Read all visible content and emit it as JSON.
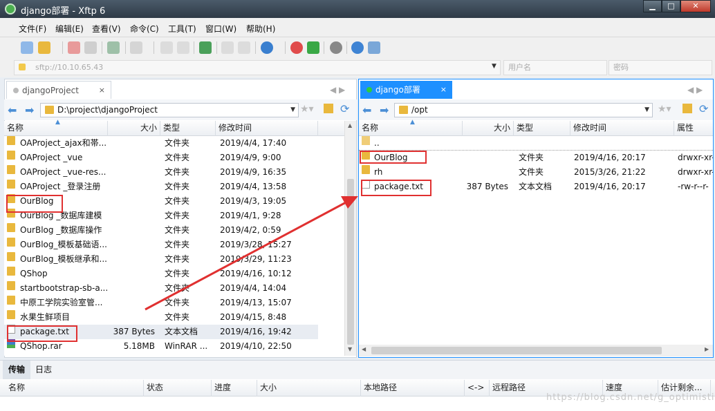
{
  "window": {
    "title": "django部署   - Xftp 6"
  },
  "menu": [
    "文件(F)",
    "编辑(E)",
    "查看(V)",
    "命令(C)",
    "工具(T)",
    "窗口(W)",
    "帮助(H)"
  ],
  "address": {
    "host": "sftp://10.10.65.43",
    "username_placeholder": "用户名",
    "password_placeholder": "密码"
  },
  "left": {
    "tab": "djangoProject",
    "tab_close": "×",
    "path": "D:\\project\\djangoProject",
    "columns": [
      "名称",
      "大小",
      "类型",
      "修改时间"
    ],
    "files": [
      {
        "name": "OAProject_ajax和帯...",
        "size": "",
        "type": "文件夹",
        "mtime": "2019/4/4, 17:40",
        "icon": "folder"
      },
      {
        "name": "OAProject _vue",
        "size": "",
        "type": "文件夹",
        "mtime": "2019/4/9, 9:00",
        "icon": "folder"
      },
      {
        "name": "OAProject _vue-res...",
        "size": "",
        "type": "文件夹",
        "mtime": "2019/4/9, 16:35",
        "icon": "folder"
      },
      {
        "name": "OAProject _登录注册",
        "size": "",
        "type": "文件夹",
        "mtime": "2019/4/4, 13:58",
        "icon": "folder"
      },
      {
        "name": "OurBlog",
        "size": "",
        "type": "文件夹",
        "mtime": "2019/4/3, 19:05",
        "icon": "folder"
      },
      {
        "name": "OurBlog _数据库建模",
        "size": "",
        "type": "文件夹",
        "mtime": "2019/4/1, 9:28",
        "icon": "folder"
      },
      {
        "name": "OurBlog _数据库操作",
        "size": "",
        "type": "文件夹",
        "mtime": "2019/4/2, 0:59",
        "icon": "folder"
      },
      {
        "name": "OurBlog_模板基础语...",
        "size": "",
        "type": "文件夹",
        "mtime": "2019/3/28, 15:27",
        "icon": "folder"
      },
      {
        "name": "OurBlog_模板继承和...",
        "size": "",
        "type": "文件夹",
        "mtime": "2019/3/29, 11:23",
        "icon": "folder"
      },
      {
        "name": "QShop",
        "size": "",
        "type": "文件夹",
        "mtime": "2019/4/16, 10:12",
        "icon": "folder"
      },
      {
        "name": "startbootstrap-sb-a...",
        "size": "",
        "type": "文件夹",
        "mtime": "2019/4/4, 14:04",
        "icon": "folder"
      },
      {
        "name": "中原工学院实验室管...",
        "size": "",
        "type": "文件夹",
        "mtime": "2019/4/13, 15:07",
        "icon": "folder"
      },
      {
        "name": "水果生鲜项目",
        "size": "",
        "type": "文件夹",
        "mtime": "2019/4/15, 8:48",
        "icon": "folder"
      },
      {
        "name": "package.txt",
        "size": "387 Bytes",
        "type": "文本文档",
        "mtime": "2019/4/16, 19:42",
        "icon": "file"
      },
      {
        "name": "QShop.rar",
        "size": "5.18MB",
        "type": "WinRAR ...",
        "mtime": "2019/4/10, 22:50",
        "icon": "rar"
      }
    ]
  },
  "right": {
    "tab": "django部署",
    "tab_close": "×",
    "path": "/opt",
    "columns": [
      "名称",
      "大小",
      "类型",
      "修改时间",
      "属性"
    ],
    "files": [
      {
        "name": "..",
        "size": "",
        "type": "",
        "mtime": "",
        "attr": "",
        "icon": "up"
      },
      {
        "name": "OurBlog",
        "size": "",
        "type": "文件夹",
        "mtime": "2019/4/16, 20:17",
        "attr": "drwxr-xr-",
        "icon": "folder"
      },
      {
        "name": "rh",
        "size": "",
        "type": "文件夹",
        "mtime": "2015/3/26, 21:22",
        "attr": "drwxr-xr-",
        "icon": "folder"
      },
      {
        "name": "package.txt",
        "size": "387 Bytes",
        "type": "文本文档",
        "mtime": "2019/4/16, 20:17",
        "attr": "-rw-r--r-",
        "icon": "file"
      }
    ]
  },
  "bottom": {
    "tabs": [
      "传输",
      "日志"
    ],
    "columns": [
      "名称",
      "状态",
      "进度",
      "大小",
      "本地路径",
      "<->",
      "远程路径",
      "速度",
      "估计剩余..."
    ]
  },
  "watermark": "https://blog.csdn.net/g_optimistic",
  "colors": {
    "accent": "#1e90ff",
    "folder": "#e9b83d",
    "highlight": "#e03030"
  }
}
